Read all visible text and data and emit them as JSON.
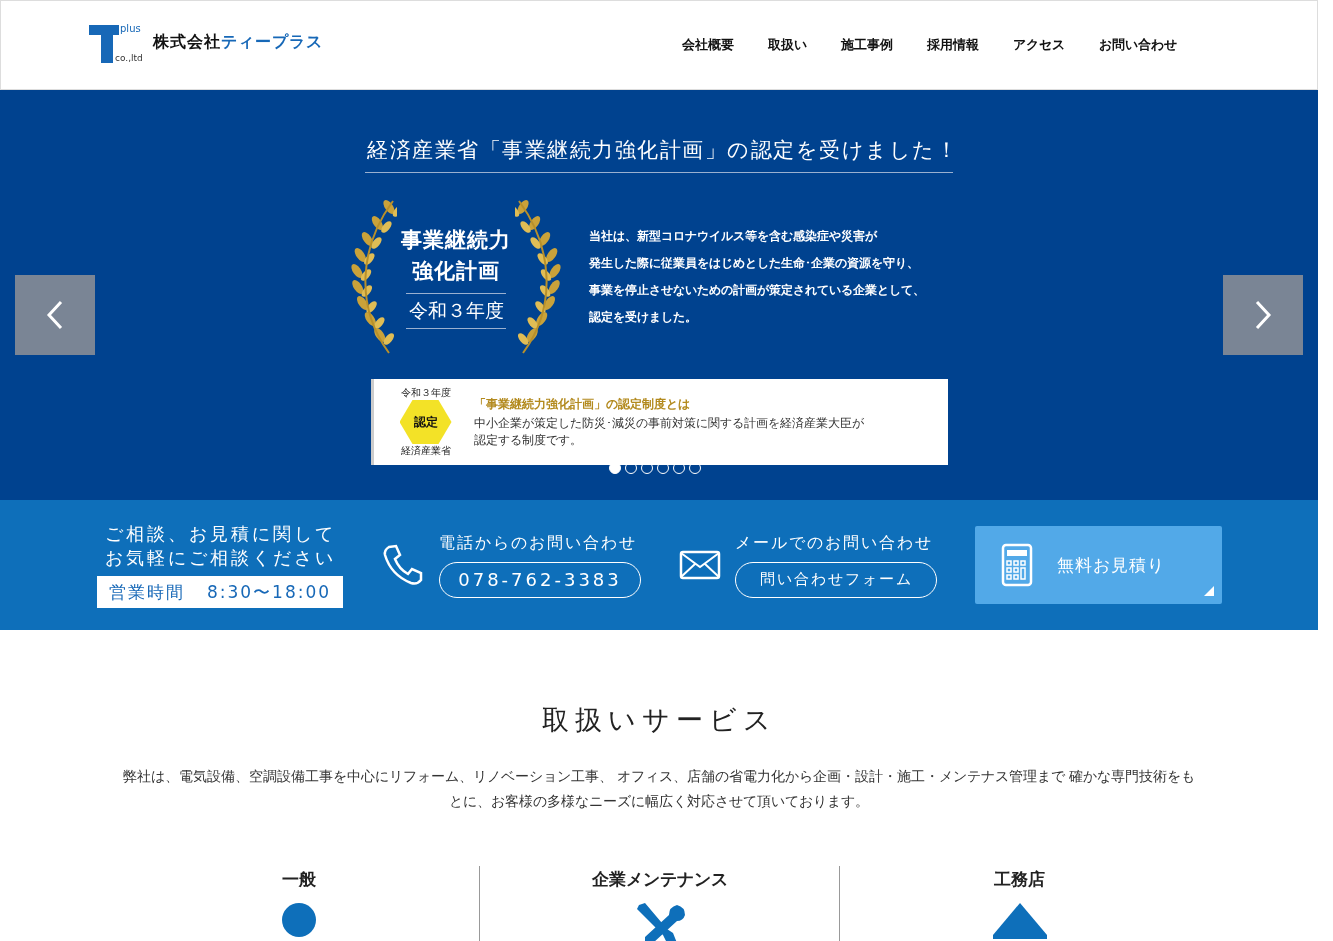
{
  "header": {
    "logo": {
      "mark_text": "plus",
      "mark_sub": "co.,ltd",
      "name_part1": "株式会社",
      "name_part2": "ティープラス"
    },
    "nav": [
      {
        "label": "会社概要"
      },
      {
        "label": "取扱い"
      },
      {
        "label": "施工事例"
      },
      {
        "label": "採用情報"
      },
      {
        "label": "アクセス"
      },
      {
        "label": "お問い合わせ"
      }
    ]
  },
  "slider": {
    "title": "経済産業省「事業継続力強化計画」の認定を受けました！",
    "award": {
      "line1": "事業継続力",
      "line2": "強化計画",
      "year": "令和３年度"
    },
    "description": [
      "当社は、新型コロナウイルス等を含む感染症や災害が",
      "発生した際に従業員をはじめとした生命･企業の資源を守り、",
      "事業を停止させないための計画が策定されている企業として、",
      "認定を受けました。"
    ],
    "info": {
      "badge_top": "令和３年度",
      "badge_center": "認定",
      "badge_bottom": "経済産業省",
      "heading": "「事業継続力強化計画」の認定制度とは",
      "text": [
        "中小企業が策定した防災･減災の事前対策に関する計画を経済産業大臣が",
        "認定する制度です。"
      ]
    },
    "dots": [
      {
        "selected": true
      },
      {
        "selected": false
      },
      {
        "selected": false
      },
      {
        "selected": false
      },
      {
        "selected": false
      },
      {
        "selected": false
      }
    ]
  },
  "contact": {
    "lead": [
      "ご相談、お見積に関して",
      "お気軽にご相談ください"
    ],
    "hours_label": "営業時間",
    "hours": "8:30〜18:00",
    "phone": {
      "heading": "電話からのお問い合わせ",
      "button": "078-762-3383"
    },
    "mail": {
      "heading": "メールでのお問い合わせ",
      "button": "問い合わせフォーム"
    },
    "estimate": {
      "label": "無料お見積り"
    }
  },
  "services": {
    "title": "取扱いサービス",
    "text": "弊社は、電気設備、空調設備工事を中心にリフォーム、リノベーション工事、 オフィス、店舗の省電力化から企画・設計・施工・メンテナス管理まで 確かな専門技術をもとに、お客様の多様なニーズに幅広く対応させて頂いております。",
    "columns": [
      {
        "title": "一般",
        "kind": "circle"
      },
      {
        "title": "企業メンテナンス",
        "kind": "tools"
      },
      {
        "title": "工務店",
        "kind": "triangle"
      }
    ]
  }
}
